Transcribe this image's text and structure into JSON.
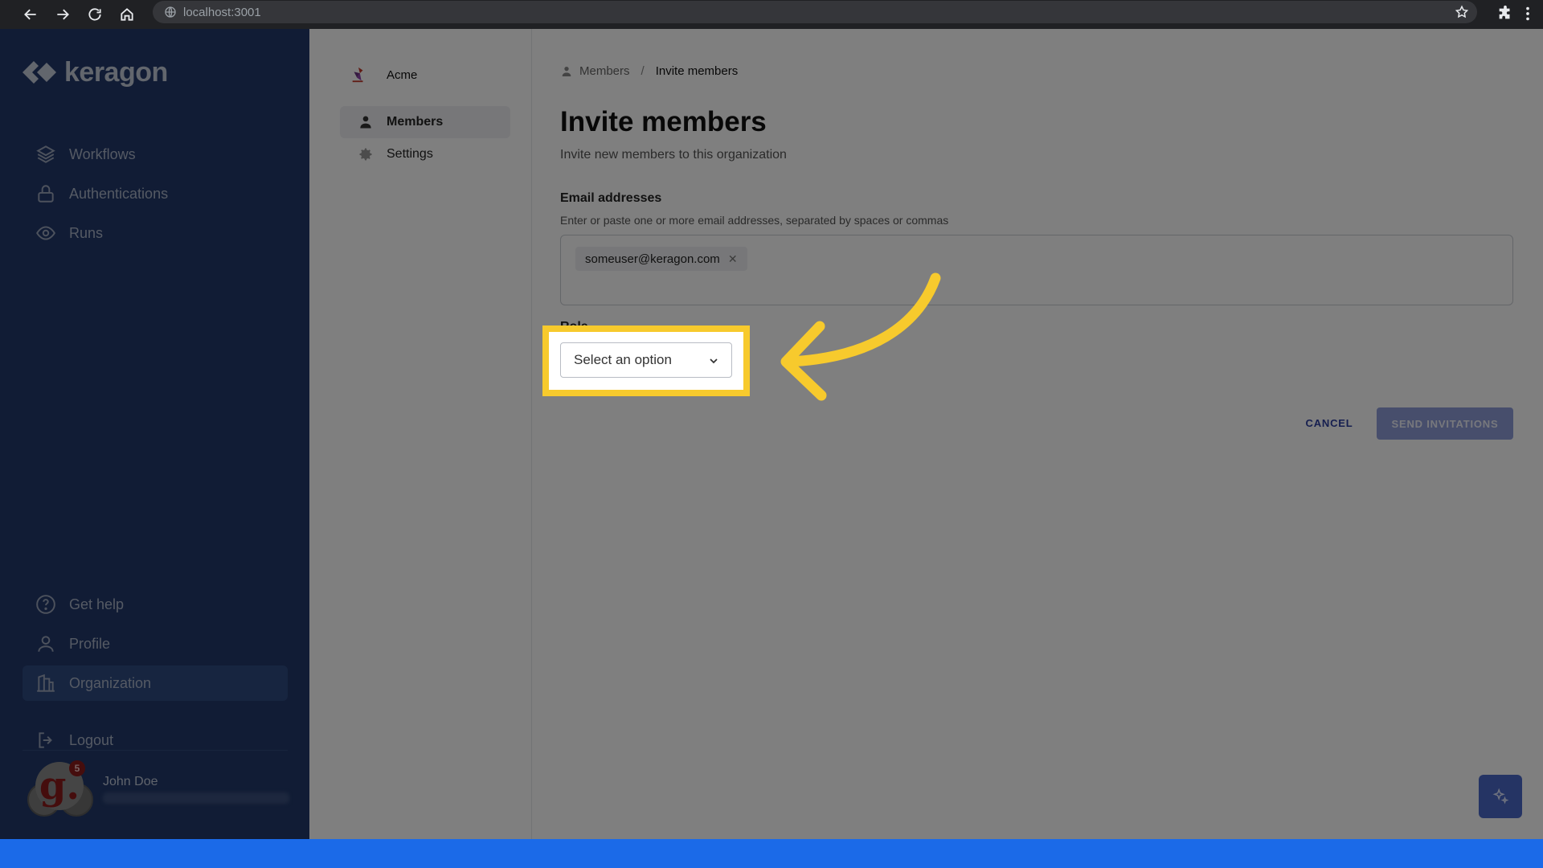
{
  "browser": {
    "url": "localhost:3001"
  },
  "sidebar": {
    "logo_text": "keragon",
    "nav": [
      {
        "label": "Workflows",
        "icon": "layers-icon"
      },
      {
        "label": "Authentications",
        "icon": "lock-icon"
      },
      {
        "label": "Runs",
        "icon": "eye-icon"
      }
    ],
    "bottom_nav": [
      {
        "label": "Get help",
        "icon": "help-circle-icon"
      },
      {
        "label": "Profile",
        "icon": "user-icon"
      },
      {
        "label": "Organization",
        "icon": "building-icon",
        "active": true
      },
      {
        "label": "Logout",
        "icon": "logout-icon"
      }
    ],
    "user": {
      "name": "John Doe",
      "avatar_letter": "g.",
      "notification_count": "5"
    }
  },
  "org_panel": {
    "org_name": "Acme",
    "items": [
      {
        "label": "Members",
        "icon": "person-icon",
        "active": true
      },
      {
        "label": "Settings",
        "icon": "gear-icon",
        "active": false
      }
    ]
  },
  "main": {
    "breadcrumb": {
      "parent": "Members",
      "separator": "/",
      "current": "Invite members"
    },
    "title": "Invite members",
    "subtitle": "Invite new members to this organization",
    "email_field": {
      "label": "Email addresses",
      "help": "Enter or paste one or more email addresses, separated by spaces or commas",
      "chips": [
        "someuser@keragon.com"
      ],
      "chip_remove": "✕"
    },
    "role_field": {
      "label": "Role",
      "placeholder": "Select an option"
    },
    "actions": {
      "cancel": "CANCEL",
      "send": "SEND INVITATIONS"
    }
  },
  "colors": {
    "sidebar_bg": "#22396a",
    "highlight": "#f7ca2d",
    "primary": "#2d3fa0",
    "primary_disabled": "#8f9dd8",
    "bottom_bar": "#1b6ae8"
  }
}
